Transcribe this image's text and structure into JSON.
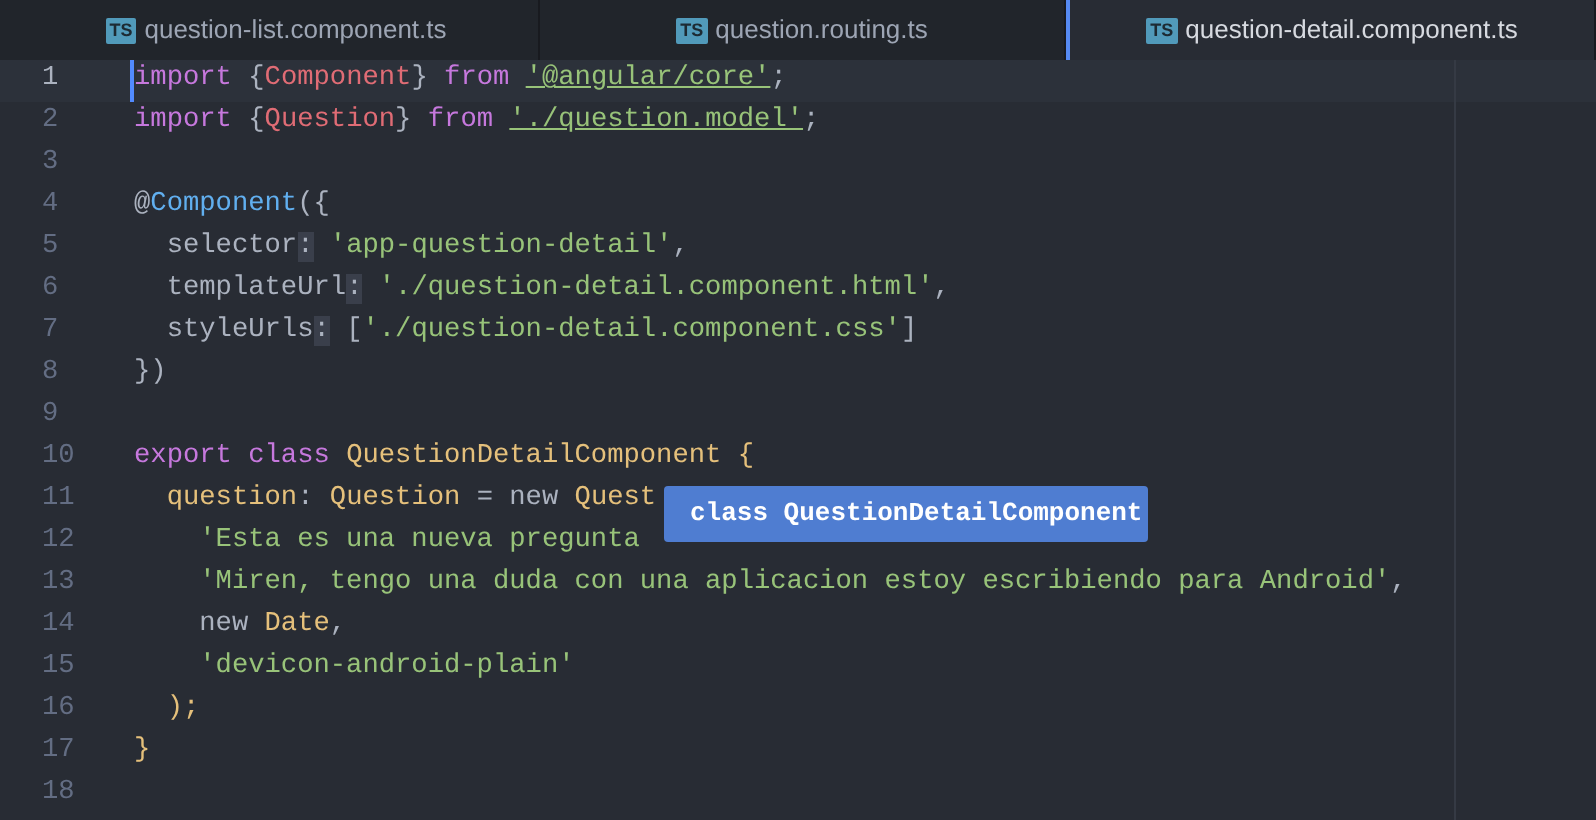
{
  "tabs": [
    {
      "icon": "TS",
      "label": "question-list.component.ts",
      "selected": false
    },
    {
      "icon": "TS",
      "label": "question.routing.ts",
      "selected": false
    },
    {
      "icon": "TS",
      "label": "question-detail.component.ts",
      "selected": true
    }
  ],
  "editor": {
    "lines": [
      {
        "number": "1",
        "current": true,
        "tokens": [
          {
            "kind": "keyword",
            "text": "import"
          },
          {
            "kind": "plain",
            "text": " {"
          },
          {
            "kind": "entity",
            "text": "Component"
          },
          {
            "kind": "plain",
            "text": "} "
          },
          {
            "kind": "keyword",
            "text": "from "
          },
          {
            "kind": "link",
            "text": "'@angular/core'"
          },
          {
            "kind": "plain",
            "text": ";"
          }
        ]
      },
      {
        "number": "2",
        "current": false,
        "tokens": [
          {
            "kind": "keyword",
            "text": "import"
          },
          {
            "kind": "plain",
            "text": " {"
          },
          {
            "kind": "entity",
            "text": "Question"
          },
          {
            "kind": "plain",
            "text": "} "
          },
          {
            "kind": "keyword",
            "text": "from "
          },
          {
            "kind": "link",
            "text": "'./question.model'"
          },
          {
            "kind": "plain",
            "text": ";"
          }
        ]
      },
      {
        "number": "3",
        "current": false
      },
      {
        "number": "4",
        "current": false,
        "tokens": [
          {
            "kind": "plain",
            "text": "@"
          },
          {
            "kind": "function",
            "text": "Component"
          },
          {
            "kind": "plain",
            "text": "({"
          }
        ]
      },
      {
        "number": "5",
        "current": false,
        "tokens": [
          {
            "kind": "plain",
            "text": "  selector"
          },
          {
            "kind": "boxed",
            "text": ":"
          },
          {
            "kind": "string",
            "text": " 'app-question-detail'"
          },
          {
            "kind": "plain",
            "text": ","
          }
        ]
      },
      {
        "number": "6",
        "current": false,
        "tokens": [
          {
            "kind": "plain",
            "text": "  templateUrl"
          },
          {
            "kind": "boxed",
            "text": ":"
          },
          {
            "kind": "string",
            "text": " './question-detail.component.html'"
          },
          {
            "kind": "plain",
            "text": ","
          }
        ]
      },
      {
        "number": "7",
        "current": false,
        "tokens": [
          {
            "kind": "plain",
            "text": "  styleUrls"
          },
          {
            "kind": "boxed",
            "text": ":"
          },
          {
            "kind": "plain",
            "text": " ["
          },
          {
            "kind": "string",
            "text": "'./question-detail.component.css'"
          },
          {
            "kind": "plain",
            "text": "]"
          }
        ]
      },
      {
        "number": "8",
        "current": false,
        "tokens": [
          {
            "kind": "plain",
            "text": "})"
          }
        ]
      },
      {
        "number": "9",
        "current": false
      },
      {
        "number": "10",
        "current": false,
        "tokens": [
          {
            "kind": "keyword",
            "text": "export class "
          },
          {
            "kind": "class",
            "text": "QuestionDetailComponent {"
          }
        ]
      },
      {
        "number": "11",
        "current": false,
        "tokens": [
          {
            "kind": "class",
            "text": "  question"
          },
          {
            "kind": "plain",
            "text": ": "
          },
          {
            "kind": "class",
            "text": "Question"
          },
          {
            "kind": "plain",
            "text": " = new "
          },
          {
            "kind": "class",
            "text": "Quest"
          }
        ]
      },
      {
        "number": "12",
        "current": false,
        "tokens": [
          {
            "kind": "string",
            "text": "    'Esta es una nueva pregunta"
          }
        ]
      },
      {
        "number": "13",
        "current": false,
        "tokens": [
          {
            "kind": "string",
            "text": "    'Miren, tengo una duda con una aplicacion estoy escribiendo para Android'"
          },
          {
            "kind": "plain",
            "text": ","
          }
        ]
      },
      {
        "number": "14",
        "current": false,
        "tokens": [
          {
            "kind": "plain",
            "text": "    new "
          },
          {
            "kind": "class",
            "text": "Date"
          },
          {
            "kind": "plain",
            "text": ","
          }
        ]
      },
      {
        "number": "15",
        "current": false,
        "tokens": [
          {
            "kind": "string",
            "text": "    'devicon-android-plain'"
          }
        ]
      },
      {
        "number": "16",
        "current": false,
        "tokens": [
          {
            "kind": "class",
            "text": "  );"
          }
        ]
      },
      {
        "number": "17",
        "current": false,
        "tokens": [
          {
            "kind": "class",
            "text": "}"
          }
        ]
      },
      {
        "number": "18",
        "current": false
      }
    ]
  },
  "tooltip": {
    "text": "class QuestionDetailComponent"
  }
}
